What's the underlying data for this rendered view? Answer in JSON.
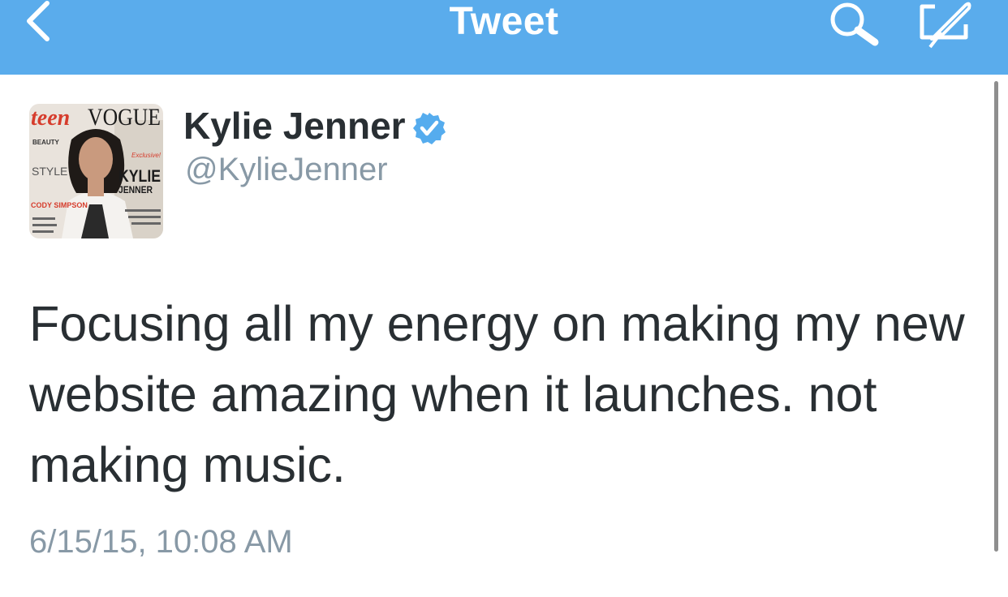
{
  "nav": {
    "title": "Tweet",
    "back_icon": "chevron-left-icon",
    "search_icon": "search-icon",
    "compose_icon": "compose-icon"
  },
  "tweet": {
    "display_name": "Kylie Jenner",
    "handle": "@KylieJenner",
    "verified": true,
    "avatar_cover": {
      "masthead_left": "teen",
      "masthead_right": "VOGUE",
      "cover_lines": [
        "BEAUTY",
        "STYLE",
        "Exclusive!",
        "KYLIE",
        "JENNER",
        "CODY SIMPSON"
      ]
    },
    "text": "Focusing all my energy on making my new website amazing when it launches. not making music.",
    "timestamp": "6/15/15, 10:08 AM"
  },
  "colors": {
    "nav_background": "#5aacec",
    "verified_badge": "#55acee",
    "primary_text": "#292f33",
    "secondary_text": "#8899a6"
  }
}
